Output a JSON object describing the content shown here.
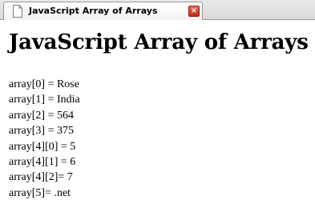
{
  "tab": {
    "title": "JavaScript Array of Arrays",
    "icon": "document-icon",
    "close_glyph": "×"
  },
  "page": {
    "heading": "JavaScript Array of Arrays",
    "lines": [
      "array[0] = Rose",
      "array[1] = India",
      "array[2] = 564",
      "array[3] = 375",
      "array[4][0] = 5",
      "array[4][1] = 6",
      "array[4][2]= 7",
      "array[5]= .net"
    ]
  },
  "colors": {
    "close_button": "#d23a2a",
    "tabbar": "#e0e0e0",
    "background": "#ffffff"
  }
}
